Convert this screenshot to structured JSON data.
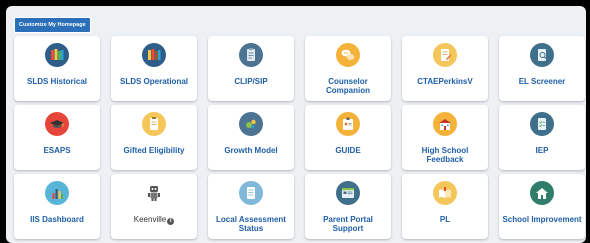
{
  "customize_button": "Customize My Homepage",
  "tiles": [
    {
      "label": "SLDS Historical",
      "icon": "books-icon"
    },
    {
      "label": "SLDS Operational",
      "icon": "books-icon"
    },
    {
      "label": "CLIP/SIP",
      "icon": "clipboard-icon"
    },
    {
      "label": "Counselor Companion",
      "icon": "chat-bubbles-icon"
    },
    {
      "label": "CTAEPerkinsV",
      "icon": "document-pencil-icon"
    },
    {
      "label": "EL Screener",
      "icon": "magnify-document-icon"
    },
    {
      "label": "ESAPS",
      "icon": "graduation-cap-icon"
    },
    {
      "label": "Gifted Eligibility",
      "icon": "clipboard-icon"
    },
    {
      "label": "Growth Model",
      "icon": "bubble-chart-icon"
    },
    {
      "label": "GUIDE",
      "icon": "id-badge-icon"
    },
    {
      "label": "High School Feedback",
      "icon": "school-building-icon"
    },
    {
      "label": "IEP",
      "icon": "checklist-icon"
    },
    {
      "label": "IIS Dashboard",
      "icon": "bar-chart-icon"
    },
    {
      "label": "Keenville",
      "icon": "robot-icon",
      "has_info": true
    },
    {
      "label": "Local Assessment Status",
      "icon": "form-icon"
    },
    {
      "label": "Parent Portal Support",
      "icon": "browser-window-icon"
    },
    {
      "label": "PL",
      "icon": "open-book-icon"
    },
    {
      "label": "School Improvement",
      "icon": "house-icon"
    }
  ]
}
